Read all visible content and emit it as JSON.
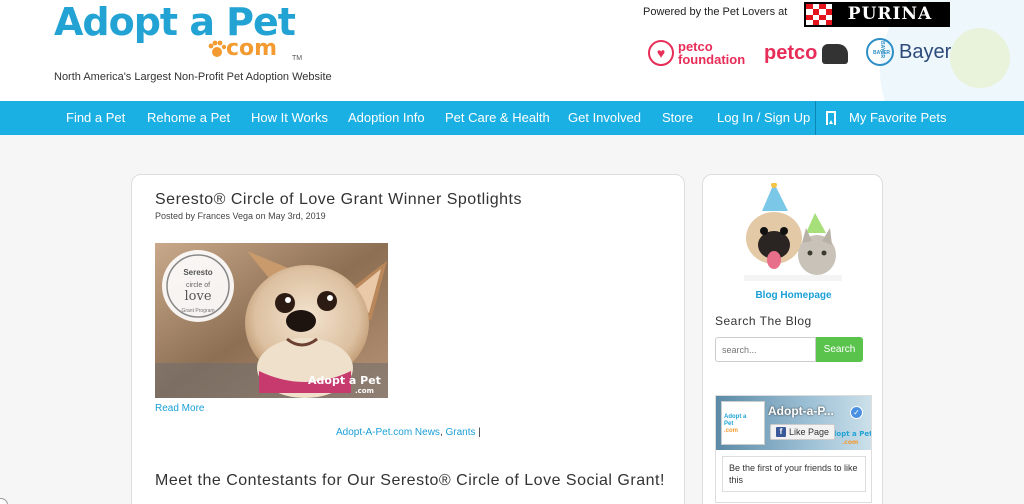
{
  "header": {
    "logo_main": "Adopt a Pet",
    "logo_dotcom": "com",
    "logo_tm": "TM",
    "tagline": "North America's Largest Non-Profit Pet Adoption Website",
    "powered_by": "Powered by the Pet Lovers at",
    "sponsors": {
      "purina": "PURINA",
      "petco_foundation": [
        "petco",
        "foundation"
      ],
      "petco": "petco",
      "bayer": "Bayer",
      "bayer_cross": "BAYER"
    }
  },
  "nav": {
    "items": [
      "Find a Pet",
      "Rehome a Pet",
      "How It Works",
      "Adoption Info",
      "Pet Care & Health",
      "Get Involved",
      "Store",
      "Log In / Sign Up"
    ],
    "favorites": "My Favorite Pets"
  },
  "posts": [
    {
      "title": "Seresto® Circle of Love Grant Winner Spotlights",
      "meta": "Posted by Frances Vega on May 3rd, 2019",
      "image_badge": {
        "brand": "Seresto",
        "line1": "circle of",
        "line2": "love",
        "ring": "Grant Program"
      },
      "image_watermark": [
        "Adopt a Pet",
        ".com"
      ],
      "read_more": "Read More",
      "tags": [
        "Adopt-A-Pet.com News",
        "Grants"
      ],
      "tag_separator": ",",
      "tag_end": "|"
    },
    {
      "title": "Meet the Contestants for Our Seresto® Circle of Love Social Grant!"
    }
  ],
  "sidebar": {
    "blog_homepage": "Blog Homepage",
    "search_heading": "Search The Blog",
    "search_placeholder": "search...",
    "search_button": "Search",
    "facebook": {
      "page_name": "Adopt-a-P...",
      "thumb_lines": [
        "Adopt a",
        "Pet",
        ".com"
      ],
      "cover_brand": [
        "Adopt a Pet",
        ".com"
      ],
      "like_label": "Like Page",
      "like_icon": "f",
      "verified_icon": "✓",
      "friends_text": "Be the first of your friends to like this"
    }
  },
  "colors": {
    "nav_bg": "#1bb0e3",
    "link": "#1a9fd6",
    "search_button": "#5ac34c",
    "logo_blue": "#22a3d4",
    "logo_orange": "#f39a31",
    "petco_red": "#e72d58"
  },
  "icons": [
    "bookmark-icon",
    "paw-icon",
    "heart-icon",
    "facebook-icon",
    "verified-icon",
    "bayer-cross-icon"
  ]
}
